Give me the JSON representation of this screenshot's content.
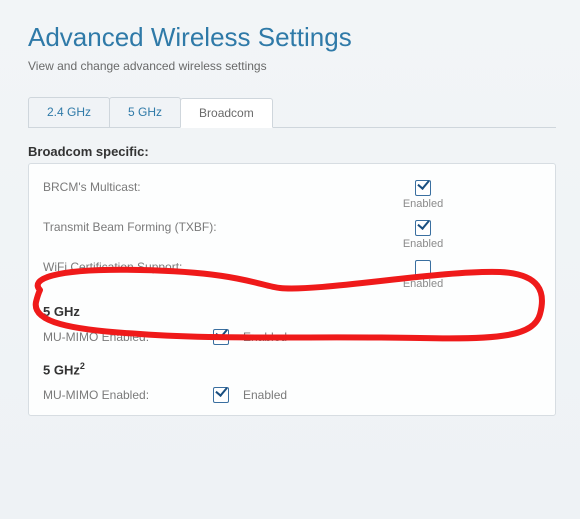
{
  "header": {
    "title": "Advanced Wireless Settings",
    "subtitle": "View and change advanced wireless settings"
  },
  "tabs": {
    "items": [
      {
        "label": "2.4 GHz",
        "active": false
      },
      {
        "label": "5 GHz",
        "active": false
      },
      {
        "label": "Broadcom",
        "active": true
      }
    ]
  },
  "broadcom": {
    "section_title": "Broadcom specific:",
    "rows": {
      "multicast": {
        "label": "BRCM's Multicast:",
        "checked": true,
        "status": "Enabled"
      },
      "txbf": {
        "label": "Transmit Beam Forming (TXBF):",
        "checked": true,
        "status": "Enabled"
      },
      "wifi_cert": {
        "label": "WiFi Certification Support:",
        "checked": false,
        "status": "Enabled"
      }
    },
    "g5": {
      "title": "5 GHz",
      "mu_label": "MU-MIMO Enabled:",
      "checked": true,
      "status": "Enabled"
    },
    "g52": {
      "title_prefix": "5 GHz",
      "title_sup": "2",
      "mu_label": "MU-MIMO Enabled:",
      "checked": true,
      "status": "Enabled"
    }
  }
}
